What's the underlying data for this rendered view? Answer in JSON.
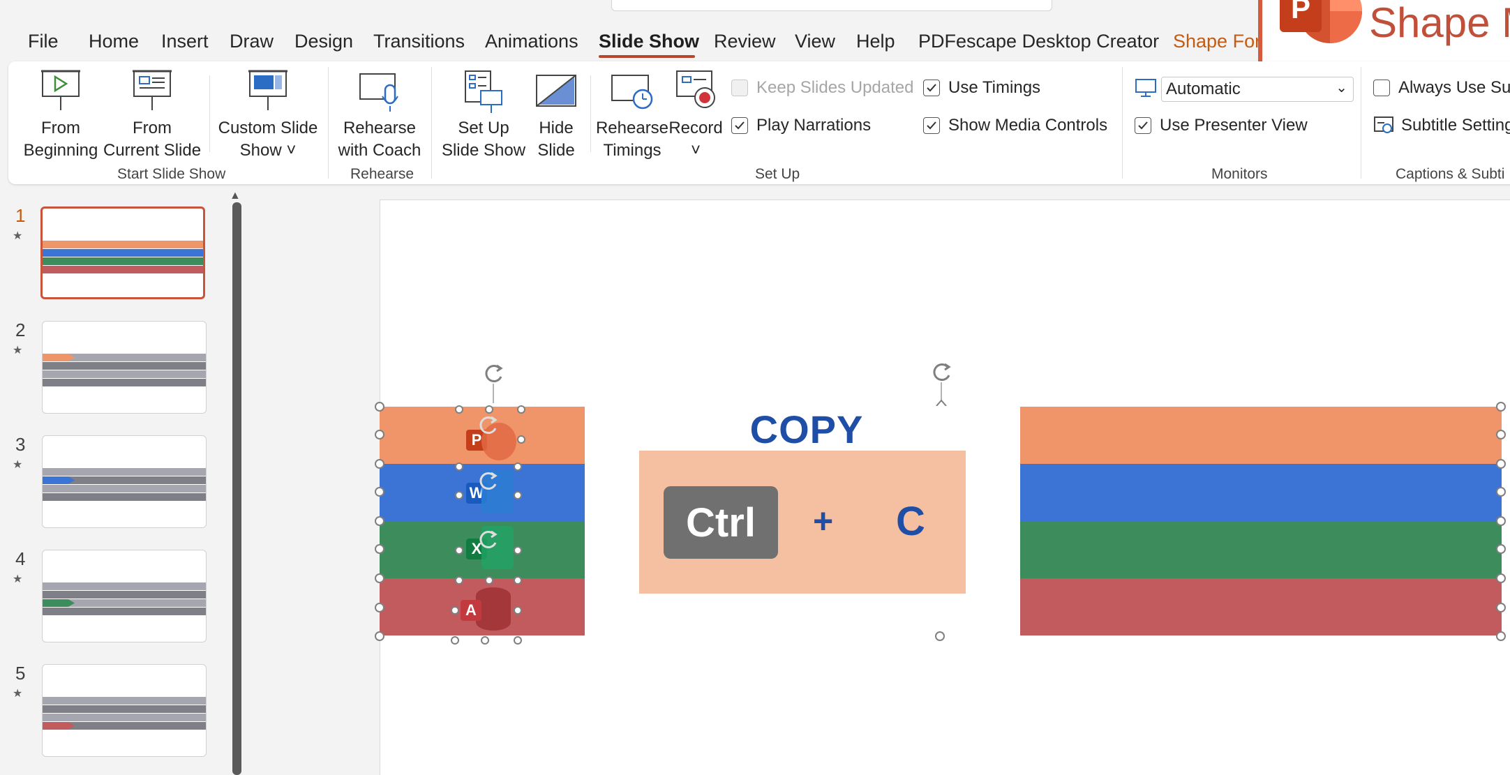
{
  "menu": {
    "tabs": [
      "File",
      "Home",
      "Insert",
      "Draw",
      "Design",
      "Transitions",
      "Animations",
      "Slide Show",
      "Review",
      "View",
      "Help",
      "PDFescape Desktop Creator",
      "Shape For"
    ],
    "active_tab": "Slide Show"
  },
  "badge": {
    "text": "Shape M",
    "logo_letter": "P",
    "border_color": "#d55b3f"
  },
  "ribbon": {
    "start": {
      "from_beginning": [
        "From",
        "Beginning"
      ],
      "from_current": [
        "From",
        "Current Slide"
      ],
      "custom_show": [
        "Custom Slide",
        "Show ˅"
      ],
      "group_label": "Start Slide Show"
    },
    "rehearse": {
      "coach": [
        "Rehearse",
        "with Coach"
      ],
      "group_label": "Rehearse"
    },
    "setup": {
      "setup_show": [
        "Set Up",
        "Slide Show"
      ],
      "hide_slide": [
        "Hide",
        "Slide"
      ],
      "rehearse_timings": [
        "Rehearse",
        "Timings"
      ],
      "record": [
        "Record",
        "˅"
      ],
      "keep_updated": "Keep Slides Updated",
      "play_narrations": "Play Narrations",
      "use_timings": "Use Timings",
      "show_media": "Show Media Controls",
      "group_label": "Set Up"
    },
    "monitors": {
      "monitor_value": "Automatic",
      "presenter_view": "Use Presenter View",
      "group_label": "Monitors"
    },
    "captions": {
      "always_use_subtitles": "Always Use Sub",
      "subtitle_settings": "Subtitle Setting",
      "group_label": "Captions & Subti"
    }
  },
  "checkbox_states": {
    "keep_updated": false,
    "play_narrations": true,
    "use_timings": true,
    "show_media": true,
    "presenter_view": true,
    "always_use_subtitles": false
  },
  "slides": [
    {
      "number": "1",
      "star": "★",
      "highlight": "all"
    },
    {
      "number": "2",
      "star": "★",
      "highlight": "#f0956a"
    },
    {
      "number": "3",
      "star": "★",
      "highlight": "#3c74d6"
    },
    {
      "number": "4",
      "star": "★",
      "highlight": "#3d8d5c"
    },
    {
      "number": "5",
      "star": "★",
      "highlight": "#c15b5d"
    }
  ],
  "slide_content": {
    "copy_title": "COPY",
    "key1": "Ctrl",
    "plus": "+",
    "key2": "C",
    "app_letters": [
      "P",
      "W",
      "X",
      "A"
    ],
    "band_colors": [
      "#f0956a",
      "#3c74d6",
      "#3d8d5c",
      "#c15b5d"
    ],
    "accent": "#1f4ea6",
    "keybox_color": "#f5bfa1"
  }
}
